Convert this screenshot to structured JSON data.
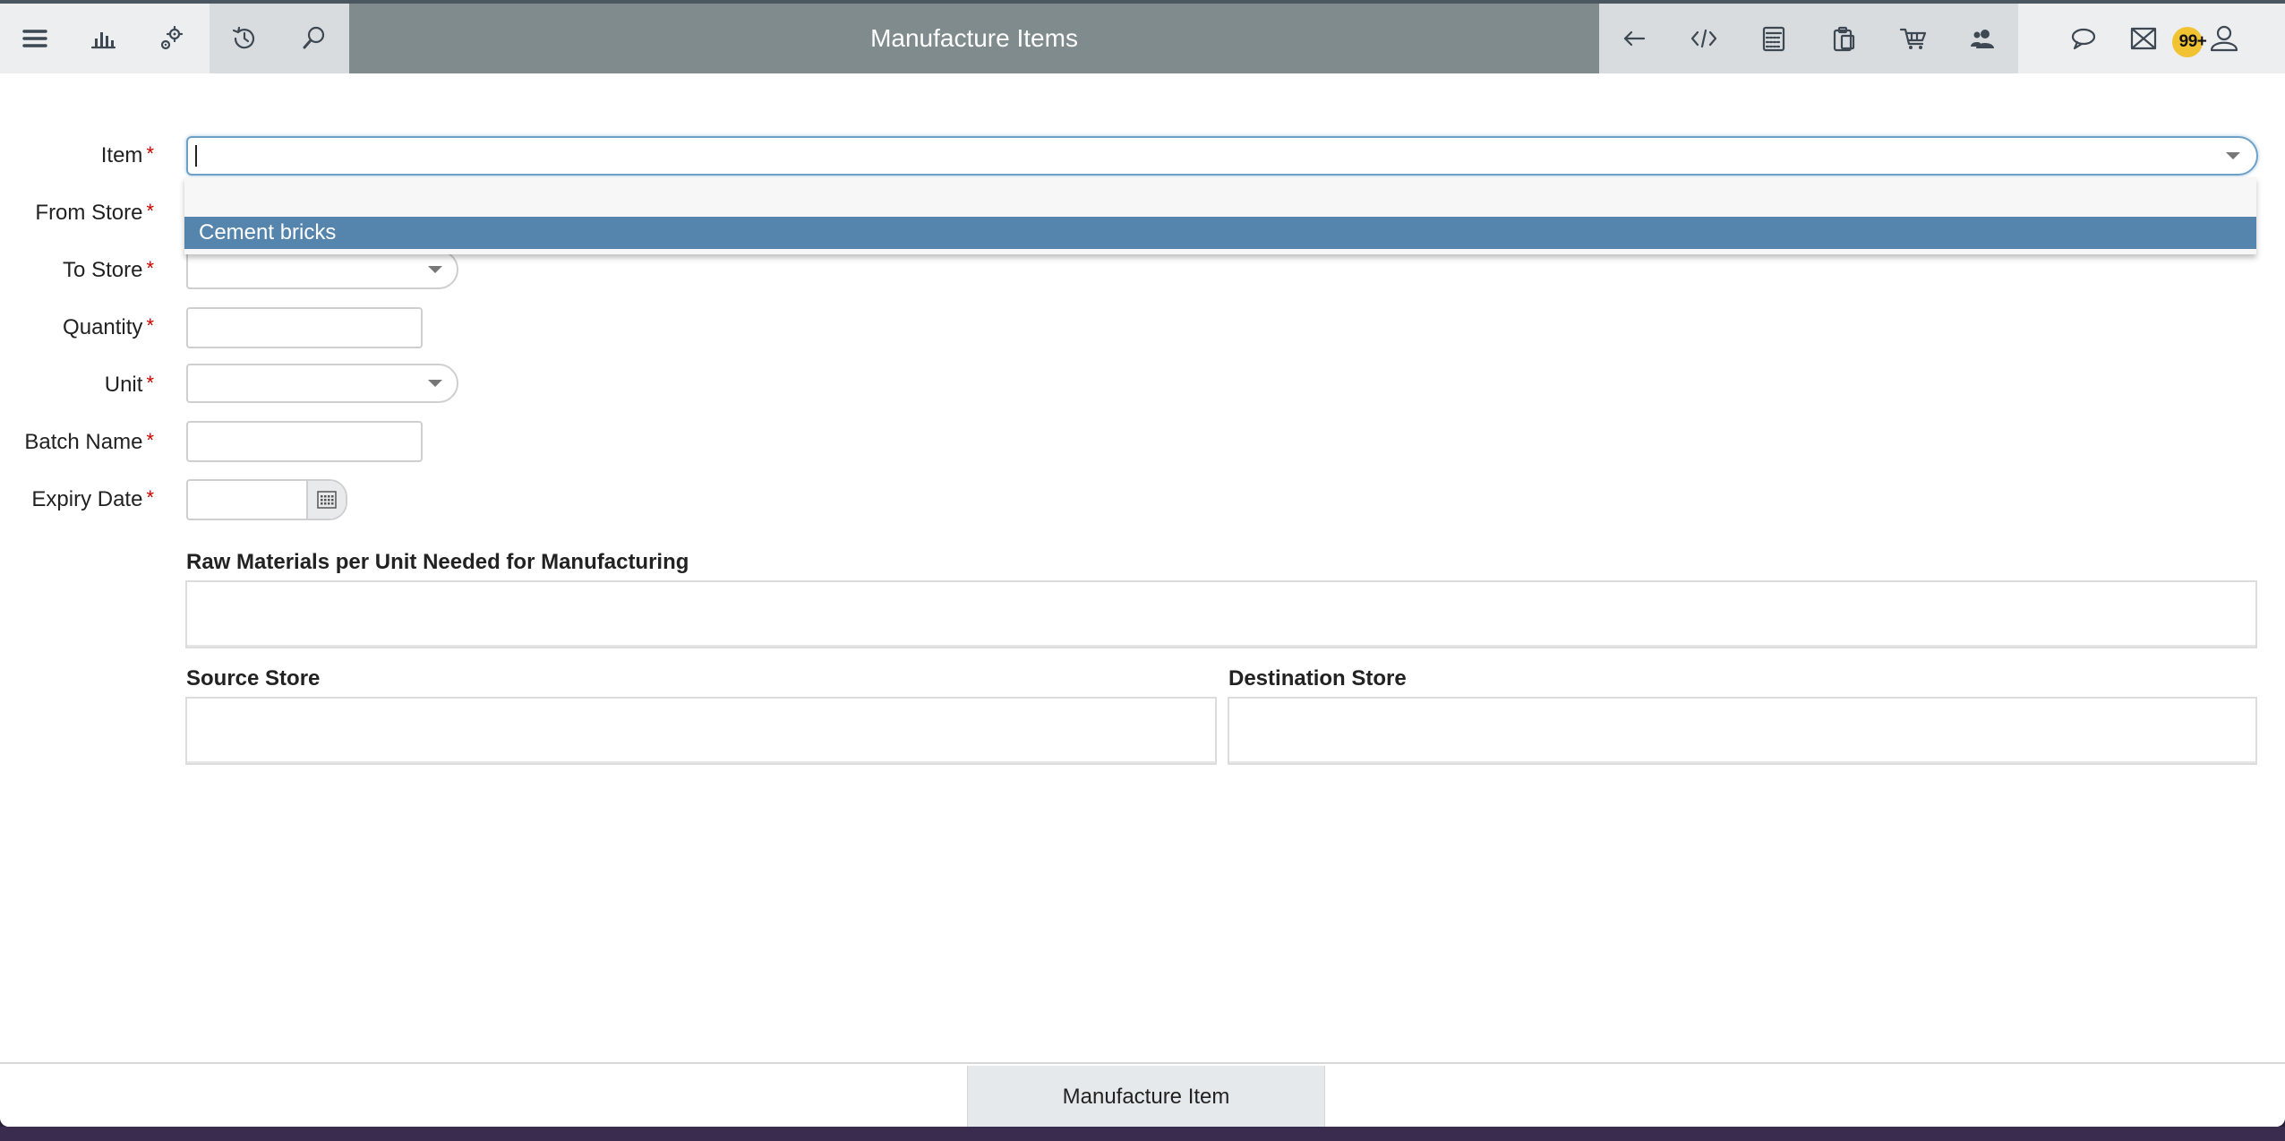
{
  "header": {
    "title": "Manufacture Items",
    "left_icons": [
      "menu-icon",
      "bar-chart-icon",
      "gears-icon",
      "history-icon",
      "search-icon"
    ],
    "right_icons": [
      "back-arrow-icon",
      "code-icon",
      "calculator-icon",
      "clipboard-icon",
      "cart-icon",
      "contacts-icon",
      "chat-icon",
      "mail-icon",
      "user-icon"
    ],
    "notification_badge": "99+"
  },
  "form": {
    "item": {
      "label": "Item",
      "value": ""
    },
    "from_store": {
      "label": "From Store"
    },
    "to_store": {
      "label": "To Store"
    },
    "quantity": {
      "label": "Quantity",
      "value": ""
    },
    "unit": {
      "label": "Unit"
    },
    "batch_name": {
      "label": "Batch Name",
      "value": ""
    },
    "expiry_date": {
      "label": "Expiry Date",
      "value": ""
    },
    "required_mark": "*"
  },
  "dropdown": {
    "options": [
      "",
      "Cement bricks"
    ],
    "highlighted": "Cement bricks"
  },
  "sections": {
    "raw_materials": "Raw Materials per Unit Needed for Manufacturing",
    "source_store": "Source Store",
    "destination_store": "Destination Store"
  },
  "footer": {
    "button_label": "Manufacture Item"
  },
  "colors": {
    "title_bar": "#7f8b8c",
    "highlight": "#5585ad",
    "required": "#cc0000",
    "badge": "#f1c232"
  }
}
